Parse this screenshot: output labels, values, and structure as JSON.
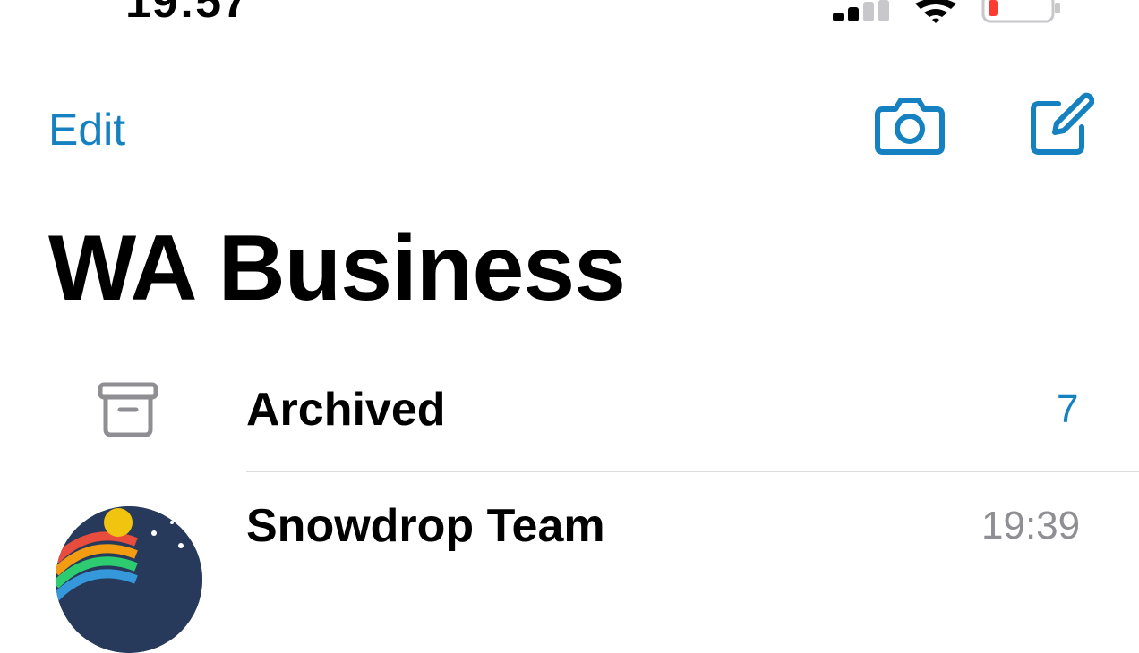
{
  "status_bar": {
    "time": "19:57",
    "icons": [
      "cellular-signal-icon",
      "wifi-icon",
      "battery-low-icon"
    ]
  },
  "nav": {
    "edit_label": "Edit",
    "camera_icon": "camera-icon",
    "compose_icon": "compose-icon"
  },
  "title": "WA Business",
  "archived": {
    "icon": "archive-box-icon",
    "label": "Archived",
    "count": "7"
  },
  "chats": [
    {
      "name": "Snowdrop Team",
      "time": "19:39"
    }
  ],
  "colors": {
    "accent": "#1581c0",
    "secondary_text": "#8e8e93",
    "divider": "#dcdcdc",
    "battery_low": "#ff3b30"
  }
}
